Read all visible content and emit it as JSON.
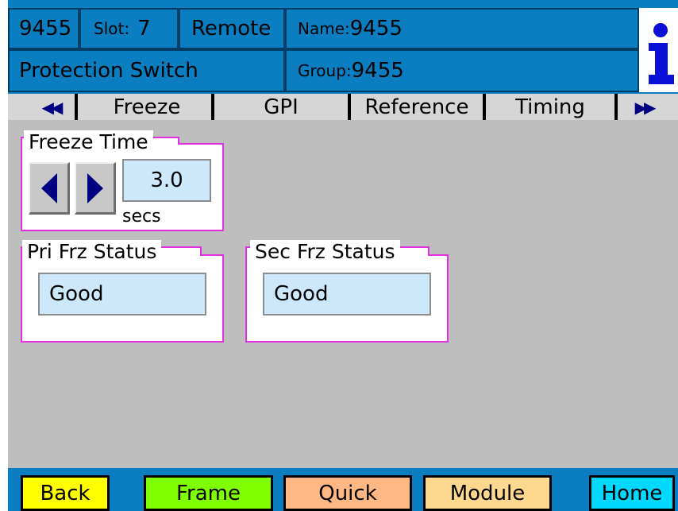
{
  "header": {
    "device_id": "9455",
    "slot_label": "Slot:",
    "slot_value": "7",
    "mode": "Remote",
    "name_label": "Name:",
    "name_value": "9455",
    "function": "Protection Switch",
    "group_label": "Group:",
    "group_value": "9455",
    "info_icon": "info-icon",
    "info_glyph": "i"
  },
  "tabs": {
    "prev_glyph": "◀◀",
    "next_glyph": "▶▶",
    "items": [
      {
        "label": "Freeze",
        "selected": true
      },
      {
        "label": "GPI",
        "selected": false
      },
      {
        "label": "Reference",
        "selected": false
      },
      {
        "label": "Timing",
        "selected": false
      }
    ]
  },
  "freeze_time": {
    "title": "Freeze Time",
    "value": "3.0",
    "unit": "secs",
    "decrement_icon": "triangle-left-icon",
    "increment_icon": "triangle-right-icon"
  },
  "pri_status": {
    "title": "Pri Frz Status",
    "value": "Good"
  },
  "sec_status": {
    "title": "Sec Frz Status",
    "value": "Good"
  },
  "footer": {
    "back": "Back",
    "frame": "Frame",
    "quick": "Quick",
    "module": "Module",
    "home": "Home"
  },
  "colors": {
    "header_blue": "#0a7ec0",
    "border_magenta": "#e030e0",
    "field_light_blue": "#cde8fb",
    "arrow_navy": "#000082",
    "back_yellow": "#ffff00",
    "frame_green": "#80ff00",
    "quick_orange": "#ffb784",
    "module_tan": "#ffd890",
    "home_cyan": "#00d8ff"
  }
}
